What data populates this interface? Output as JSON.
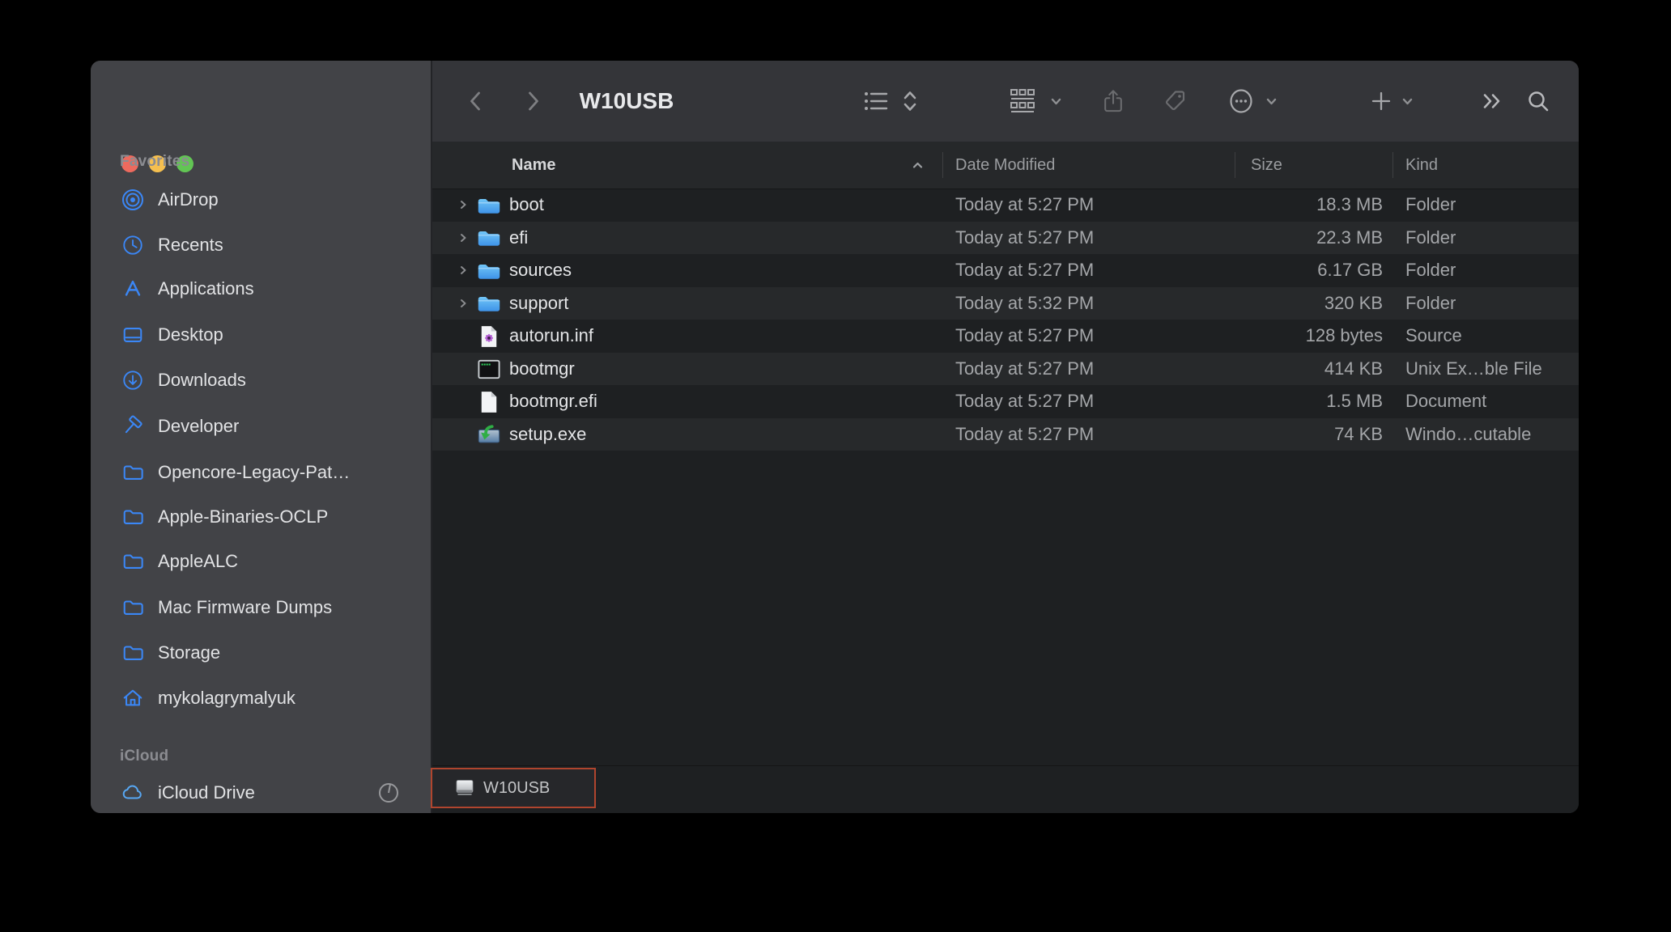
{
  "window": {
    "title": "W10USB"
  },
  "colors": {
    "accent_blue": "#3b87f6",
    "folder_blue_top": "#71c6f8",
    "folder_blue_bottom": "#3e93e8",
    "annotation_red": "#b0452e",
    "traffic_red": "#ed6a5e",
    "traffic_yellow": "#f5bf4f",
    "traffic_green": "#62c554",
    "sidebar_bg": "#424347",
    "toolbar_bg": "#343539",
    "row_stripe": "#27292b"
  },
  "toolbar": {
    "buttons": [
      "back-chevron-icon",
      "forward-chevron-icon",
      "view-list-icon",
      "view-updown-chevrons-icon",
      "group-icon",
      "share-icon",
      "tag-icon",
      "more-circle-icon",
      "add-icon",
      "overflow-chevrons-icon",
      "search-icon"
    ]
  },
  "sidebar": {
    "sections": [
      {
        "label": "Favorites",
        "items": [
          {
            "label": "AirDrop",
            "icon": "airdrop-icon"
          },
          {
            "label": "Recents",
            "icon": "clock-icon"
          },
          {
            "label": "Applications",
            "icon": "app-store-icon"
          },
          {
            "label": "Desktop",
            "icon": "desktop-icon"
          },
          {
            "label": "Downloads",
            "icon": "download-circle-icon"
          },
          {
            "label": "Developer",
            "icon": "hammer-icon"
          },
          {
            "label": "Opencore-Legacy-Pat…",
            "icon": "folder-outline-icon"
          },
          {
            "label": "Apple-Binaries-OCLP",
            "icon": "folder-outline-icon"
          },
          {
            "label": "AppleALC",
            "icon": "folder-outline-icon"
          },
          {
            "label": "Mac Firmware Dumps",
            "icon": "folder-outline-icon"
          },
          {
            "label": "Storage",
            "icon": "folder-outline-icon"
          },
          {
            "label": "mykolagrymalyuk",
            "icon": "home-icon"
          }
        ]
      },
      {
        "label": "iCloud",
        "items": [
          {
            "label": "iCloud Drive",
            "icon": "cloud-icon",
            "status_icon": "sync-progress-icon"
          }
        ]
      }
    ]
  },
  "list": {
    "columns": [
      {
        "label": "Name",
        "sort": "ascending"
      },
      {
        "label": "Date Modified"
      },
      {
        "label": "Size"
      },
      {
        "label": "Kind"
      }
    ],
    "files": [
      {
        "name": "boot",
        "date": "Today at 5:27 PM",
        "size": "18.3 MB",
        "kind": "Folder",
        "icon": "folder-icon",
        "expandable": true
      },
      {
        "name": "efi",
        "date": "Today at 5:27 PM",
        "size": "22.3 MB",
        "kind": "Folder",
        "icon": "folder-icon",
        "expandable": true
      },
      {
        "name": "sources",
        "date": "Today at 5:27 PM",
        "size": "6.17 GB",
        "kind": "Folder",
        "icon": "folder-icon",
        "expandable": true
      },
      {
        "name": "support",
        "date": "Today at 5:32 PM",
        "size": "320 KB",
        "kind": "Folder",
        "icon": "folder-icon",
        "expandable": true
      },
      {
        "name": "autorun.inf",
        "date": "Today at 5:27 PM",
        "size": "128 bytes",
        "kind": "Source",
        "icon": "setup-information-icon"
      },
      {
        "name": "bootmgr",
        "date": "Today at 5:27 PM",
        "size": "414 KB",
        "kind": "Unix Ex…ble File",
        "icon": "unix-executable-icon"
      },
      {
        "name": "bootmgr.efi",
        "date": "Today at 5:27 PM",
        "size": "1.5 MB",
        "kind": "Document",
        "icon": "document-icon"
      },
      {
        "name": "setup.exe",
        "date": "Today at 5:27 PM",
        "size": "74 KB",
        "kind": "Windo…cutable",
        "icon": "windows-executable-icon"
      }
    ]
  },
  "pathbar": {
    "items": [
      {
        "label": "W10USB",
        "icon": "external-drive-icon",
        "annotated": true
      }
    ]
  }
}
